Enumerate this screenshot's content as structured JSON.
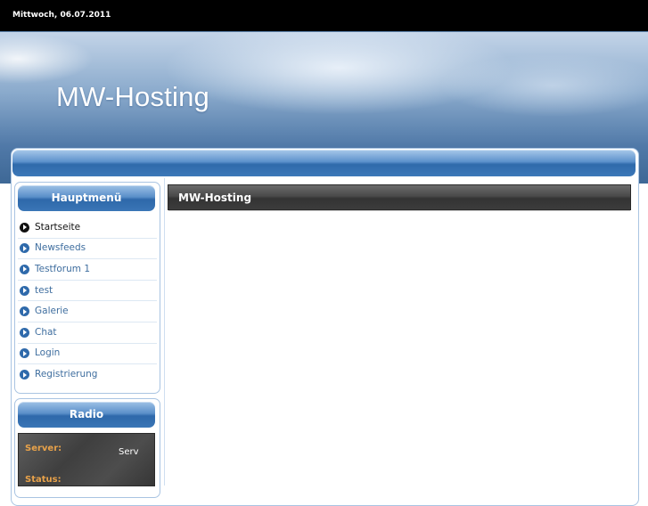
{
  "topbar": {
    "date": "Mittwoch, 06.07.2011"
  },
  "header": {
    "site_title": "MW-Hosting"
  },
  "sidebar": {
    "main_menu": {
      "title": "Hauptmenü",
      "items": [
        {
          "label": "Startseite",
          "active": true
        },
        {
          "label": "Newsfeeds",
          "active": false
        },
        {
          "label": "Testforum 1",
          "active": false
        },
        {
          "label": "test",
          "active": false
        },
        {
          "label": "Galerie",
          "active": false
        },
        {
          "label": "Chat",
          "active": false
        },
        {
          "label": "Login",
          "active": false
        },
        {
          "label": "Registrierung",
          "active": false
        }
      ]
    },
    "radio": {
      "title": "Radio",
      "server_label": "Server:",
      "server_value": "Serv",
      "status_label": "Status:"
    }
  },
  "content": {
    "heading": "MW-Hosting"
  },
  "colors": {
    "accent_blue": "#2f6aab",
    "link_color": "#3f6e9f",
    "radio_label_orange": "#e8a24a",
    "topbar_bg": "#000000"
  }
}
